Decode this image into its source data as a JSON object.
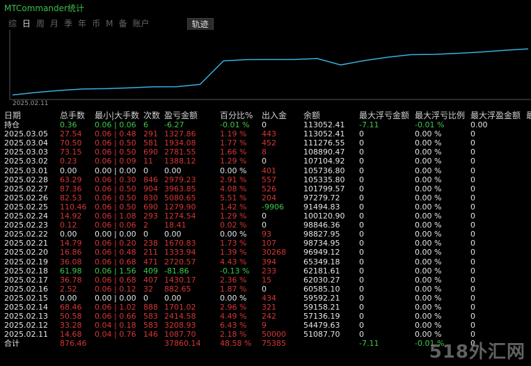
{
  "app_title": "MTCommander统计",
  "tabs": [
    "综",
    "日",
    "周",
    "月",
    "季",
    "年",
    "币",
    "M",
    "备",
    "账户",
    "轨迹"
  ],
  "active_tab": "日",
  "chart": {
    "date_label": "2025.02.11",
    "line_color": "#3ab0e0"
  },
  "columns": [
    "日期",
    "总手数",
    "最小|大手数",
    "次数",
    "盈亏金额",
    "百分比%",
    "出入金",
    "余额",
    "最大浮亏金额",
    "最大浮亏比例",
    "最大浮盈金额",
    "最"
  ],
  "hold_row": {
    "label": "持仓",
    "lots": "0.36",
    "minmax": "0.06 | 0.06",
    "count": "6",
    "pnl": "-6.27",
    "pct": "-0.01 %",
    "io": "0",
    "balance": "113052.41",
    "max_float_loss": "-7.11",
    "max_float_loss_pct": "-0.01 %",
    "max_float_profit": "0.00"
  },
  "rows": [
    {
      "date": "2025.03.05",
      "lots": "27.54",
      "minmax": "0.06 | 0.48",
      "count": "291",
      "pnl": "1327.86",
      "pct": "1.19 %",
      "io": "443",
      "balance": "113052.41",
      "mfl": "0",
      "mflp": "0.00 %",
      "mfp": "0",
      "c": "r"
    },
    {
      "date": "2025.03.04",
      "lots": "70.50",
      "minmax": "0.06 | 0.50",
      "count": "581",
      "pnl": "1934.08",
      "pct": "1.77 %",
      "io": "452",
      "balance": "111276.55",
      "mfl": "0",
      "mflp": "0.00 %",
      "mfp": "0",
      "c": "r"
    },
    {
      "date": "2025.03.03",
      "lots": "73.15",
      "minmax": "0.06 | 0.50",
      "count": "690",
      "pnl": "2781.55",
      "pct": "1.66 %",
      "io": "8",
      "balance": "108890.47",
      "mfl": "0",
      "mflp": "0.00 %",
      "mfp": "0",
      "c": "r"
    },
    {
      "date": "2025.03.02",
      "lots": "0.23",
      "minmax": "0.06 | 0.09",
      "count": "11",
      "pnl": "1388.12",
      "pct": "1.29 %",
      "io": "0",
      "balance": "107104.92",
      "mfl": "0",
      "mflp": "0.00 %",
      "mfp": "0",
      "c": "r"
    },
    {
      "date": "2025.03.01",
      "lots": "0.00",
      "minmax": "0.00 | 0.00",
      "count": "0",
      "pnl": "0.00",
      "pct": "0.00 %",
      "io": "401",
      "balance": "105736.80",
      "mfl": "0",
      "mflp": "0.00 %",
      "mfp": "0",
      "c": "w"
    },
    {
      "date": "2025.02.28",
      "lots": "63.29",
      "minmax": "0.06 | 0.30",
      "count": "846",
      "pnl": "2979.23",
      "pct": "2.91 %",
      "io": "557",
      "balance": "105335.80",
      "mfl": "0",
      "mflp": "0.00 %",
      "mfp": "0",
      "c": "r"
    },
    {
      "date": "2025.02.27",
      "lots": "87.36",
      "minmax": "0.06 | 0.50",
      "count": "904",
      "pnl": "3963.85",
      "pct": "4.08 %",
      "io": "526",
      "balance": "101799.57",
      "mfl": "0",
      "mflp": "0.00 %",
      "mfp": "0",
      "c": "r"
    },
    {
      "date": "2025.02.26",
      "lots": "82.53",
      "minmax": "0.06 | 0.50",
      "count": "830",
      "pnl": "5080.65",
      "pct": "5.51 %",
      "io": "204",
      "balance": "97279.72",
      "mfl": "0",
      "mflp": "0.00 %",
      "mfp": "0",
      "c": "r"
    },
    {
      "date": "2025.02.25",
      "lots": "110.46",
      "minmax": "0.06 | 0.50",
      "count": "690",
      "pnl": "1279.90",
      "pct": "1.42 %",
      "io": "-9906",
      "balance": "91494.83",
      "mfl": "0",
      "mflp": "0.00 %",
      "mfp": "0",
      "c": "r",
      "io_c": "g"
    },
    {
      "date": "2025.02.24",
      "lots": "14.92",
      "minmax": "0.06 | 1.08",
      "count": "293",
      "pnl": "1274.54",
      "pct": "1.29 %",
      "io": "0",
      "balance": "100120.90",
      "mfl": "0",
      "mflp": "0.00 %",
      "mfp": "0",
      "c": "r"
    },
    {
      "date": "2025.02.23",
      "lots": "0.12",
      "minmax": "0.06 | 0.06",
      "count": "2",
      "pnl": "18.41",
      "pct": "0.02 %",
      "io": "0",
      "balance": "98846.36",
      "mfl": "0",
      "mflp": "0.00 %",
      "mfp": "0",
      "c": "r"
    },
    {
      "date": "2025.02.22",
      "lots": "0.00",
      "minmax": "0.00 | 0.00",
      "count": "0",
      "pnl": "0.00",
      "pct": "0.00 %",
      "io": "93",
      "balance": "98827.95",
      "mfl": "0",
      "mflp": "0.00 %",
      "mfp": "0",
      "c": "w"
    },
    {
      "date": "2025.02.21",
      "lots": "14.79",
      "minmax": "0.06 | 0.20",
      "count": "238",
      "pnl": "1670.83",
      "pct": "1.73 %",
      "io": "107",
      "balance": "98734.95",
      "mfl": "0",
      "mflp": "0.00 %",
      "mfp": "0",
      "c": "r"
    },
    {
      "date": "2025.02.20",
      "lots": "16.86",
      "minmax": "0.06 | 0.48",
      "count": "211",
      "pnl": "1333.94",
      "pct": "1.39 %",
      "io": "30268",
      "balance": "96949.12",
      "mfl": "0",
      "mflp": "0.00 %",
      "mfp": "0",
      "c": "r"
    },
    {
      "date": "2025.02.19",
      "lots": "36.08",
      "minmax": "0.06 | 0.68",
      "count": "471",
      "pnl": "2720.57",
      "pct": "4.43 %",
      "io": "394",
      "balance": "65349.18",
      "mfl": "0",
      "mflp": "0.00 %",
      "mfp": "0",
      "c": "r"
    },
    {
      "date": "2025.02.18",
      "lots": "61.98",
      "minmax": "0.06 | 1.56",
      "count": "409",
      "pnl": "-81.86",
      "pct": "-0.13 %",
      "io": "233",
      "balance": "62181.61",
      "mfl": "0",
      "mflp": "0.00 %",
      "mfp": "0",
      "c": "g"
    },
    {
      "date": "2025.02.17",
      "lots": "36.78",
      "minmax": "0.06 | 0.68",
      "count": "407",
      "pnl": "1430.17",
      "pct": "2.36 %",
      "io": "15",
      "balance": "62030.27",
      "mfl": "0",
      "mflp": "0.00 %",
      "mfp": "0",
      "c": "r"
    },
    {
      "date": "2025.02.16",
      "lots": "2.52",
      "minmax": "0.06 | 0.12",
      "count": "32",
      "pnl": "882.65",
      "pct": "1.87 %",
      "io": "0",
      "balance": "60585.10",
      "mfl": "0",
      "mflp": "0.00 %",
      "mfp": "0",
      "c": "r"
    },
    {
      "date": "2025.02.15",
      "lots": "0.00",
      "minmax": "0.00 | 0.00",
      "count": "0",
      "pnl": "0.00",
      "pct": "0.00 %",
      "io": "434",
      "balance": "59592.21",
      "mfl": "0",
      "mflp": "0.00 %",
      "mfp": "0",
      "c": "w"
    },
    {
      "date": "2025.02.14",
      "lots": "68.46",
      "minmax": "0.06 | 1.02",
      "count": "888",
      "pnl": "1701.02",
      "pct": "2.96 %",
      "io": "321",
      "balance": "59158.21",
      "mfl": "0",
      "mflp": "0.00 %",
      "mfp": "0",
      "c": "r"
    },
    {
      "date": "2025.02.13",
      "lots": "50.58",
      "minmax": "0.06 | 0.66",
      "count": "583",
      "pnl": "2414.58",
      "pct": "4.49 %",
      "io": "242",
      "balance": "57136.19",
      "mfl": "0",
      "mflp": "0.00 %",
      "mfp": "0",
      "c": "r"
    },
    {
      "date": "2025.02.12",
      "lots": "33.28",
      "minmax": "0.04 | 0.18",
      "count": "583",
      "pnl": "3208.93",
      "pct": "6.43 %",
      "io": "9",
      "balance": "54479.63",
      "mfl": "0",
      "mflp": "0.00 %",
      "mfp": "0",
      "c": "r"
    },
    {
      "date": "2025.02.11",
      "lots": "14.68",
      "minmax": "0.04 | 0.76",
      "count": "146",
      "pnl": "1087.70",
      "pct": "2.18 %",
      "io": "50000",
      "balance": "51087.70",
      "mfl": "0",
      "mflp": "0.00 %",
      "mfp": "0",
      "c": "r"
    }
  ],
  "total_row": {
    "label": "合计",
    "lots": "876.46",
    "pnl": "37860.14",
    "pct": "48.58 %",
    "io": "75385",
    "max_float_loss": "-7.11",
    "max_float_loss_pct": "-0.01 %",
    "max_float_profit": "0"
  },
  "watermark": "518外汇网",
  "balance_series": [
    51087.7,
    54479.63,
    57136.19,
    59158.21,
    59592.21,
    60585.1,
    62030.27,
    62181.61,
    65349.18,
    96949.12,
    98734.95,
    98827.95,
    98846.36,
    100120.9,
    91494.83,
    97279.72,
    101799.57,
    105335.8,
    105736.8,
    107104.92,
    108890.47,
    111276.55,
    113052.41
  ]
}
